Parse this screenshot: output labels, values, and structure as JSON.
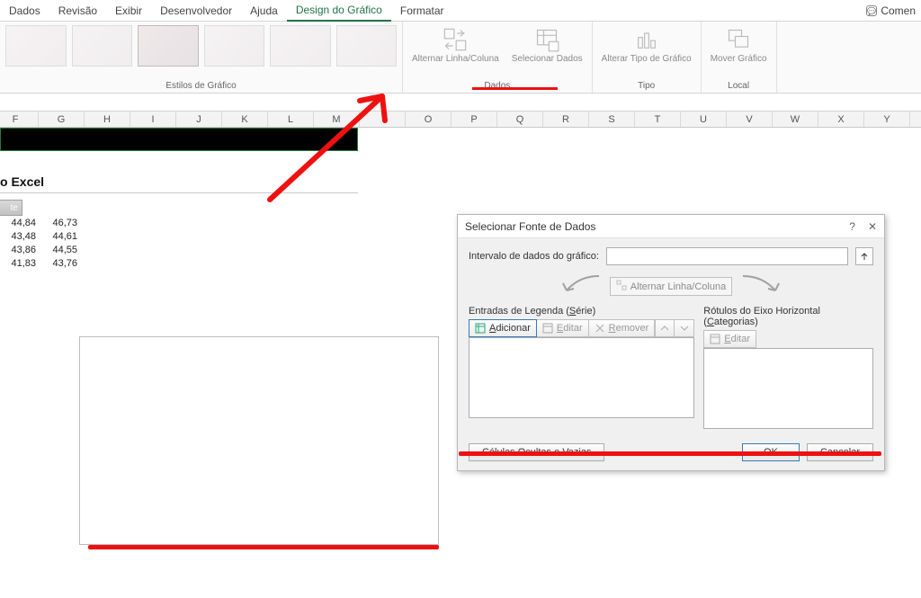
{
  "ribbon_tabs": {
    "dados": "Dados",
    "revisao": "Revisão",
    "exibir": "Exibir",
    "desenvolvedor": "Desenvolvedor",
    "ajuda": "Ajuda",
    "design": "Design do Gráfico",
    "formatar": "Formatar",
    "comen": "Comen"
  },
  "ribbon": {
    "styles_group": "Estilos de Gráfico",
    "alternar": "Alternar Linha/Coluna",
    "selecionar": "Selecionar Dados",
    "alterar_tipo": "Alterar Tipo de Gráfico",
    "mover": "Mover Gráfico",
    "dados_group": "Dados",
    "tipo_group": "Tipo",
    "local_group": "Local"
  },
  "columns": [
    "F",
    "G",
    "H",
    "I",
    "J",
    "K",
    "L",
    "M",
    "",
    "O",
    "P",
    "Q",
    "R",
    "S",
    "T",
    "U",
    "V",
    "W",
    "X",
    "Y"
  ],
  "sheet": {
    "title": "o Excel",
    "header_cell": "te",
    "rows": [
      [
        "44,84",
        "46,73"
      ],
      [
        "43,48",
        "44,61"
      ],
      [
        "43,86",
        "44,55"
      ],
      [
        "41,83",
        "43,76"
      ]
    ]
  },
  "dialog": {
    "title": "Selecionar Fonte de Dados",
    "range_label": "Intervalo de dados do gráfico:",
    "swap_btn": "Alternar Linha/Coluna",
    "series_label_pre": "Entradas de Legenda (",
    "series_label_u": "S",
    "series_label_post": "érie)",
    "adicionar_u": "A",
    "adicionar": "dicionar",
    "editar_u1": "E",
    "editar1": "ditar",
    "remover_u": "R",
    "remover": "emover",
    "cat_label_pre": "Rótulos do Eixo Horizontal (",
    "cat_label_u": "C",
    "cat_label_post": "ategorias)",
    "editar_u2": "E",
    "editar2": "ditar",
    "hidden_btn": "Células Ocultas e Vazias",
    "ok": "OK",
    "cancel": "Cancelar"
  }
}
